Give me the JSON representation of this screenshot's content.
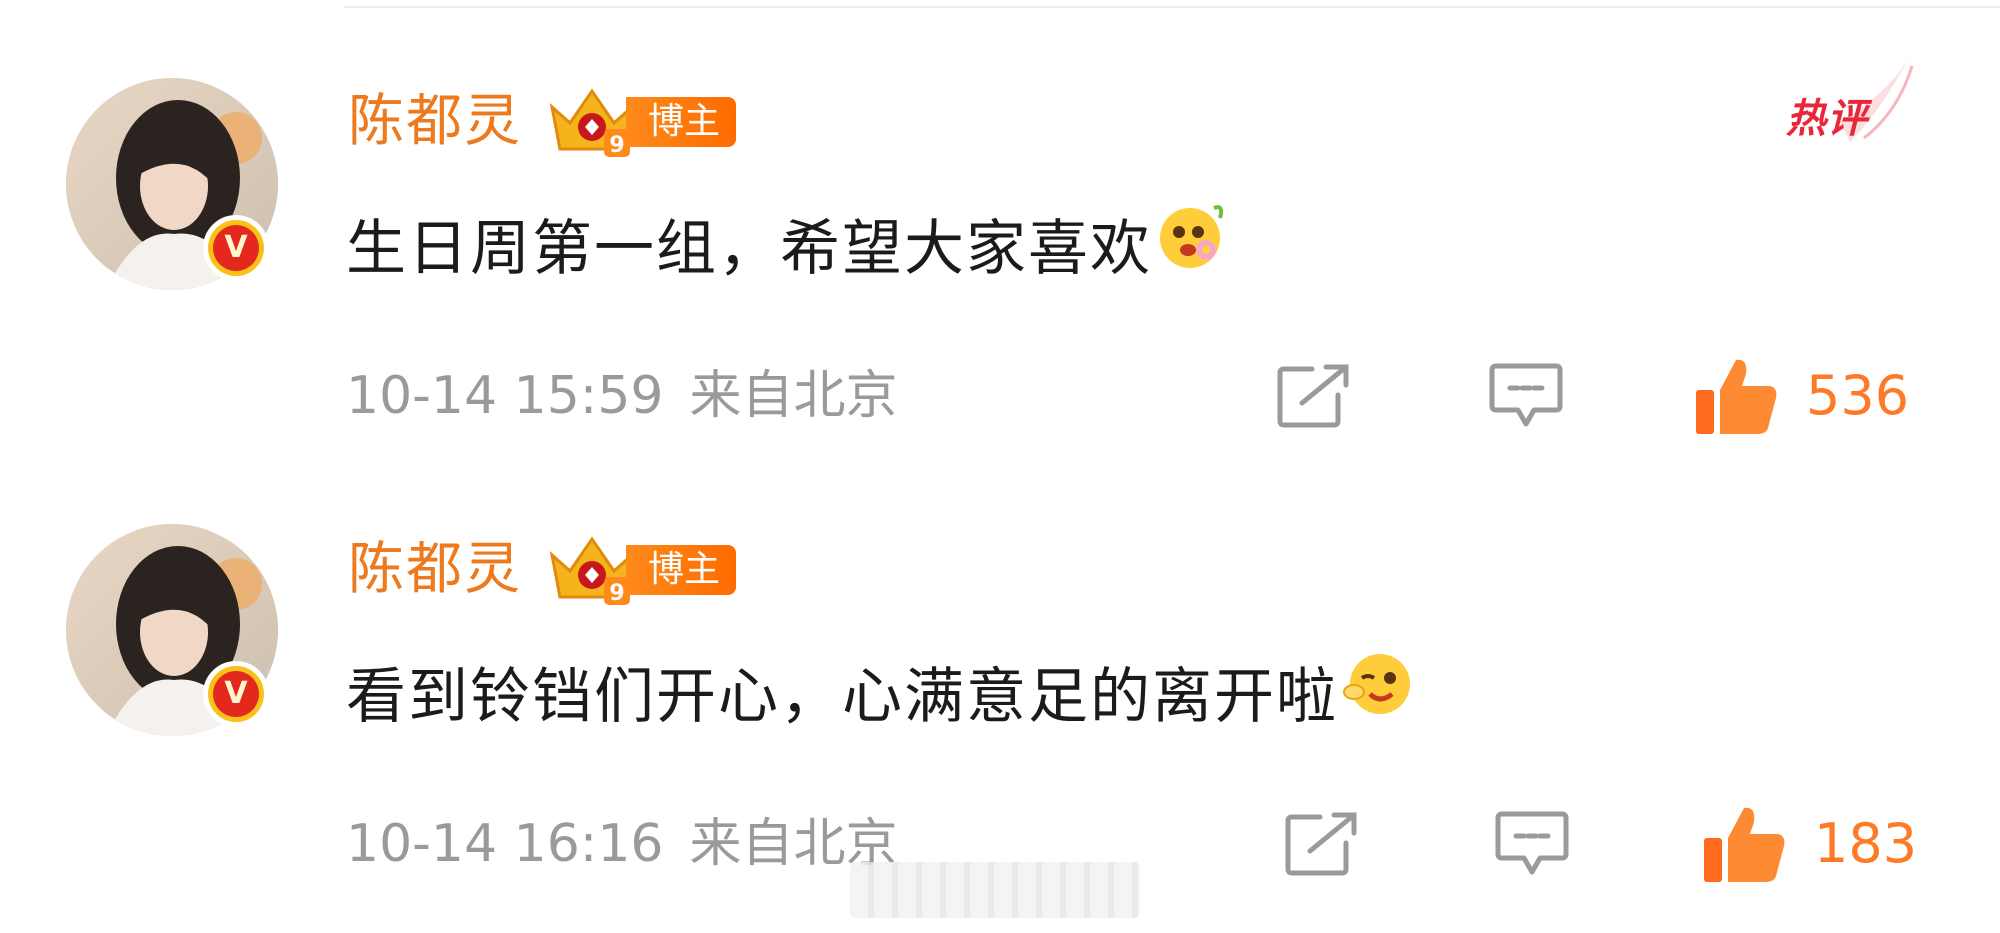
{
  "hot_tag": "热评",
  "comments": [
    {
      "username": "陈都灵",
      "badge_label": "博主",
      "badge_level": "9",
      "text": "生日周第一组，希望大家喜欢",
      "emoji": "flower-smile-emoji",
      "time": "10-14 15:59",
      "location": "来自北京",
      "likes": "536"
    },
    {
      "username": "陈都灵",
      "badge_label": "博主",
      "badge_level": "9",
      "text": "看到铃铛们开心，心满意足的离开啦",
      "emoji": "wink-emoji",
      "time": "10-14 16:16",
      "location": "来自北京",
      "likes": "183"
    }
  ],
  "colors": {
    "username": "#ee7a1e",
    "like": "#ff7a27",
    "hot": "#e8283a",
    "meta": "#9a9a9a"
  }
}
